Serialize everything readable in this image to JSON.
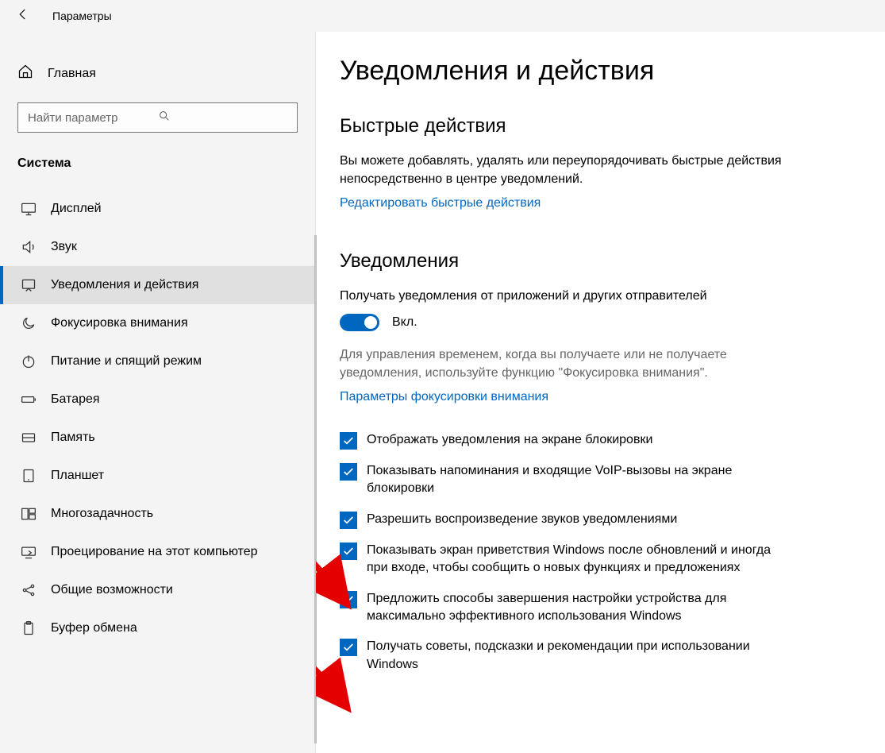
{
  "window": {
    "title": "Параметры"
  },
  "sidebar": {
    "home_label": "Главная",
    "search_placeholder": "Найти параметр",
    "group_label": "Система",
    "items": [
      {
        "icon": "display",
        "label": "Дисплей"
      },
      {
        "icon": "sound",
        "label": "Звук"
      },
      {
        "icon": "notify",
        "label": "Уведомления и действия"
      },
      {
        "icon": "moon",
        "label": "Фокусировка внимания"
      },
      {
        "icon": "power",
        "label": "Питание и спящий режим"
      },
      {
        "icon": "battery",
        "label": "Батарея"
      },
      {
        "icon": "storage",
        "label": "Память"
      },
      {
        "icon": "tablet",
        "label": "Планшет"
      },
      {
        "icon": "multitask",
        "label": "Многозадачность"
      },
      {
        "icon": "project",
        "label": "Проецирование на этот компьютер"
      },
      {
        "icon": "shared",
        "label": "Общие возможности"
      },
      {
        "icon": "clipboard",
        "label": "Буфер обмена"
      }
    ]
  },
  "main": {
    "title": "Уведомления и действия",
    "quick": {
      "heading": "Быстрые действия",
      "desc": "Вы можете добавлять, удалять или переупорядочивать быстрые действия непосредственно в центре уведомлений.",
      "edit_link": "Редактировать быстрые действия"
    },
    "notif": {
      "heading": "Уведомления",
      "source_label": "Получать уведомления от приложений и других отправителей",
      "toggle_state": "Вкл.",
      "focus_desc": "Для управления временем, когда вы получаете или не получаете уведомления, используйте функцию \"Фокусировка внимания\".",
      "focus_link": "Параметры фокусировки внимания",
      "checks": [
        "Отображать уведомления на экране блокировки",
        "Показывать напоминания и входящие VoIP-вызовы на экране блокировки",
        "Разрешить  воспроизведение звуков уведомлениями",
        "Показывать экран приветствия Windows после обновлений и иногда при входе, чтобы сообщить о новых функциях и предложениях",
        "Предложить способы завершения настройки устройства для максимально эффективного использования Windows",
        "Получать советы, подсказки и рекомендации при использовании Windows"
      ]
    }
  }
}
